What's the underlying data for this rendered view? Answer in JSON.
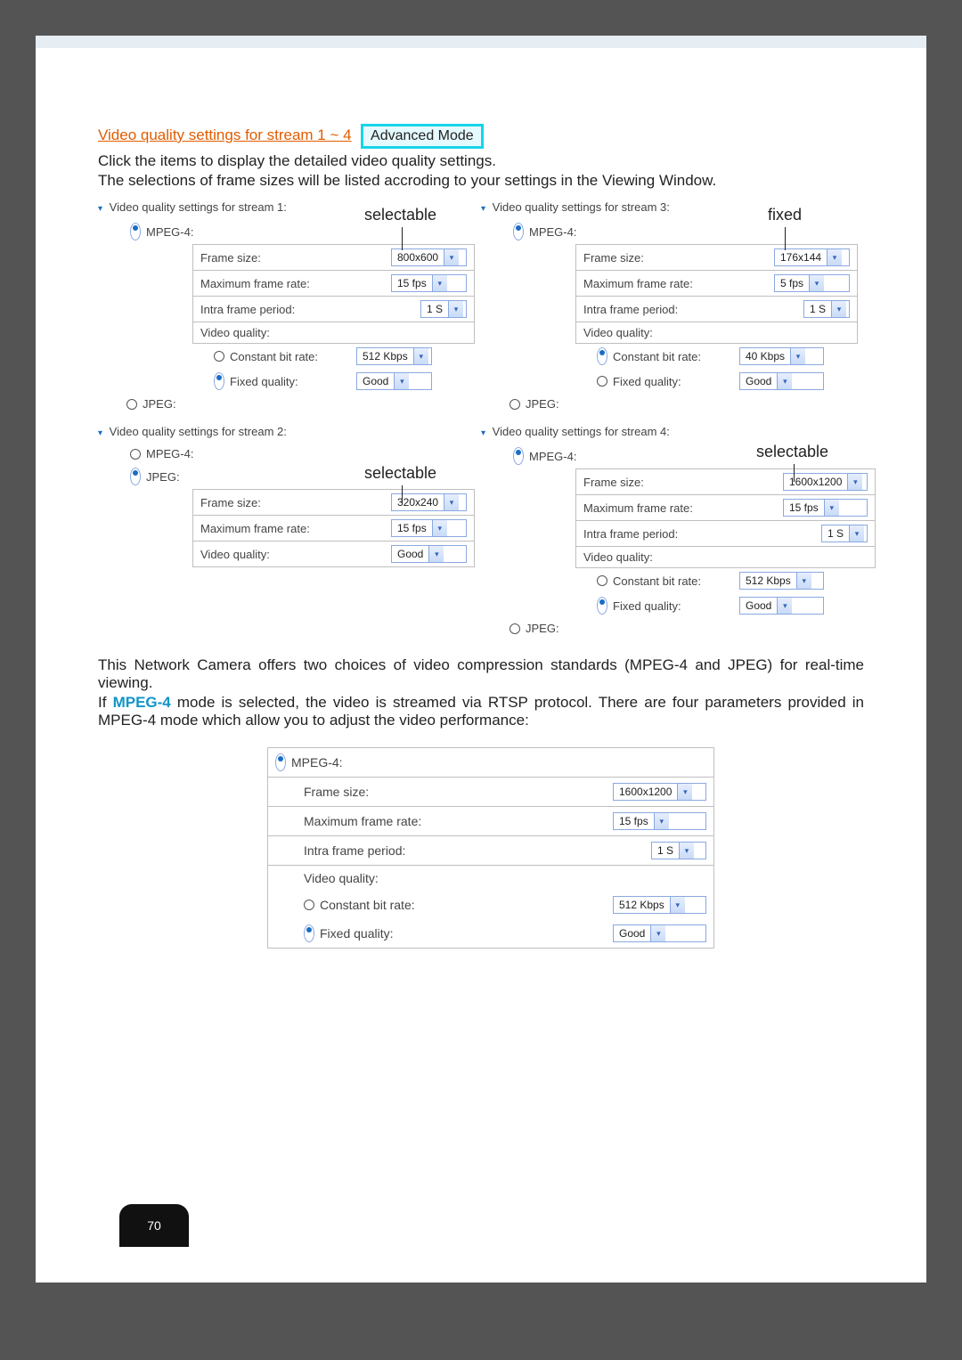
{
  "title": {
    "link_text": "Video quality settings for stream 1 ~ 4",
    "badge": "Advanced Mode"
  },
  "intro": {
    "line1": "Click the items to display the detailed video quality settings.",
    "line2": "The selections of frame sizes will be listed accroding to your settings in the Viewing Window."
  },
  "annot": {
    "s1": "selectable",
    "s3": "fixed",
    "s2": "selectable",
    "s4": "selectable"
  },
  "streams": {
    "s1": {
      "heading": "Video quality settings for stream 1:",
      "mpeg4": "MPEG-4:",
      "jpeg": "JPEG:",
      "rows": {
        "frame_size": {
          "label": "Frame size:",
          "value": "800x600"
        },
        "max_rate": {
          "label": "Maximum frame rate:",
          "value": "15 fps"
        },
        "intra": {
          "label": "Intra frame period:",
          "value": "1 S"
        },
        "vq": {
          "label": "Video quality:"
        },
        "cbr": {
          "label": "Constant bit rate:",
          "value": "512 Kbps"
        },
        "fq": {
          "label": "Fixed quality:",
          "value": "Good"
        }
      }
    },
    "s2": {
      "heading": "Video quality settings for stream 2:",
      "mpeg4": "MPEG-4:",
      "jpeg": "JPEG:",
      "rows": {
        "frame_size": {
          "label": "Frame size:",
          "value": "320x240"
        },
        "max_rate": {
          "label": "Maximum frame rate:",
          "value": "15 fps"
        },
        "vq": {
          "label": "Video quality:",
          "value": "Good"
        }
      }
    },
    "s3": {
      "heading": "Video quality settings for stream 3:",
      "mpeg4": "MPEG-4:",
      "jpeg": "JPEG:",
      "rows": {
        "frame_size": {
          "label": "Frame size:",
          "value": "176x144"
        },
        "max_rate": {
          "label": "Maximum frame rate:",
          "value": "5 fps"
        },
        "intra": {
          "label": "Intra frame period:",
          "value": "1 S"
        },
        "vq": {
          "label": "Video quality:"
        },
        "cbr": {
          "label": "Constant bit rate:",
          "value": "40 Kbps"
        },
        "fq": {
          "label": "Fixed quality:",
          "value": "Good"
        }
      }
    },
    "s4": {
      "heading": "Video quality settings for stream 4:",
      "mpeg4": "MPEG-4:",
      "jpeg": "JPEG:",
      "rows": {
        "frame_size": {
          "label": "Frame size:",
          "value": "1600x1200"
        },
        "max_rate": {
          "label": "Maximum frame rate:",
          "value": "15 fps"
        },
        "intra": {
          "label": "Intra frame period:",
          "value": "1 S"
        },
        "vq": {
          "label": "Video quality:"
        },
        "cbr": {
          "label": "Constant bit rate:",
          "value": "512 Kbps"
        },
        "fq": {
          "label": "Fixed quality:",
          "value": "Good"
        }
      }
    }
  },
  "para": {
    "p1": "This Network Camera offers two choices of video compression standards (MPEG-4 and JPEG) for real-time viewing.",
    "p2_pre": "If ",
    "p2_mpeg": "MPEG-4",
    "p2_post": " mode is selected, the video is streamed via RTSP protocol. There are four parameters provided in MPEG-4 mode which allow you to adjust the video performance:"
  },
  "detail": {
    "mpeg4": "MPEG-4:",
    "rows": {
      "frame_size": {
        "label": "Frame size:",
        "value": "1600x1200"
      },
      "max_rate": {
        "label": "Maximum frame rate:",
        "value": "15 fps"
      },
      "intra": {
        "label": "Intra frame period:",
        "value": "1 S"
      },
      "vq": {
        "label": "Video quality:"
      },
      "cbr": {
        "label": "Constant bit rate:",
        "value": "512 Kbps"
      },
      "fq": {
        "label": "Fixed quality:",
        "value": "Good"
      }
    }
  },
  "page_number": "70"
}
